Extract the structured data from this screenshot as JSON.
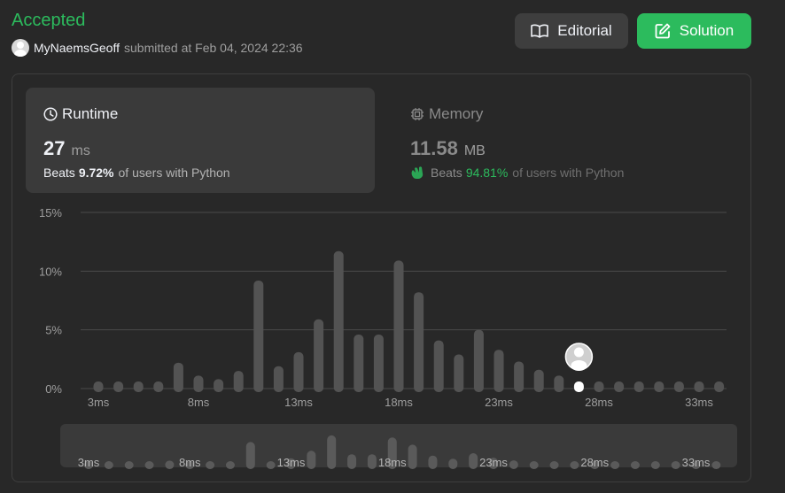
{
  "status": "Accepted",
  "submission": {
    "username": "MyNaemsGeoff",
    "submitted_text": "submitted at Feb 04, 2024 22:36"
  },
  "buttons": {
    "editorial": "Editorial",
    "solution": "Solution"
  },
  "runtime": {
    "title": "Runtime",
    "value": "27",
    "unit": "ms",
    "beats_label": "Beats",
    "beats_pct": "9.72%",
    "beats_suffix": "of users with Python"
  },
  "memory": {
    "title": "Memory",
    "value": "11.58",
    "unit": "MB",
    "beats_label": "Beats",
    "beats_pct": "94.81%",
    "beats_suffix": "of users with Python"
  },
  "colors": {
    "accent_green": "#2cbb5d",
    "bar": "#535353",
    "grid": "#4a4a4a"
  },
  "chart_data": {
    "type": "bar",
    "title": "",
    "xlabel": "",
    "ylabel": "",
    "ylim": [
      0,
      15
    ],
    "y_ticks": [
      "15%",
      "10%",
      "5%",
      "0%"
    ],
    "x_tick_labels": [
      "3ms",
      "8ms",
      "13ms",
      "18ms",
      "23ms",
      "28ms",
      "33ms"
    ],
    "categories": [
      "3ms",
      "4ms",
      "5ms",
      "6ms",
      "7ms",
      "8ms",
      "9ms",
      "10ms",
      "11ms",
      "12ms",
      "13ms",
      "14ms",
      "15ms",
      "16ms",
      "17ms",
      "18ms",
      "19ms",
      "20ms",
      "21ms",
      "22ms",
      "23ms",
      "24ms",
      "25ms",
      "26ms",
      "27ms",
      "28ms",
      "29ms",
      "30ms",
      "31ms",
      "32ms",
      "33ms",
      "34ms"
    ],
    "values": [
      0.3,
      0.3,
      0.3,
      0.3,
      2.2,
      1.1,
      0.8,
      1.5,
      9.2,
      1.9,
      3.1,
      5.9,
      11.7,
      4.6,
      4.6,
      10.9,
      8.2,
      4.1,
      2.9,
      5.0,
      3.3,
      2.3,
      1.6,
      1.1,
      0.45,
      0.3,
      0.45,
      0.6,
      0.45,
      0.35,
      0.35,
      0.35
    ],
    "highlight_category": "27ms",
    "grid": true,
    "legend": "none"
  }
}
